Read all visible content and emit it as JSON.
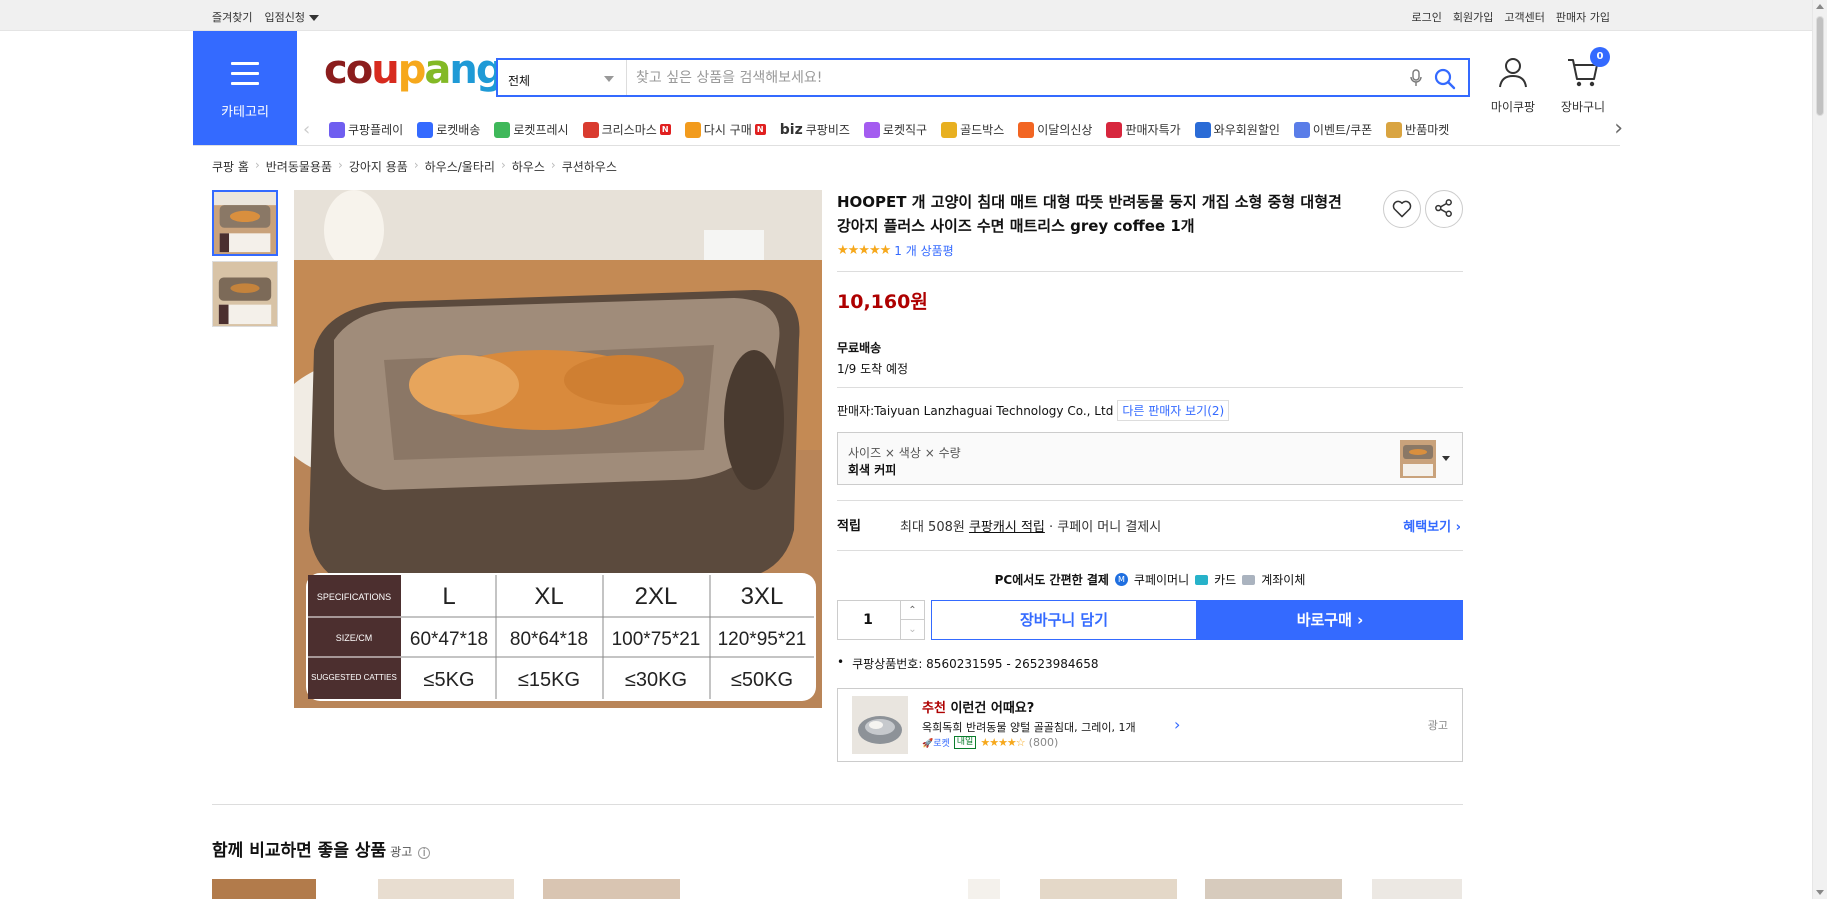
{
  "topbar": {
    "left": {
      "bookmark": "즐겨찾기",
      "seller_apply": "입점신청"
    },
    "right": [
      "로그인",
      "회원가입",
      "고객센터",
      "판매자 가입"
    ]
  },
  "header": {
    "category_label": "카테고리",
    "logo_letters": [
      "c",
      "o",
      "u",
      "p",
      "a",
      "n",
      "g"
    ],
    "search": {
      "select_value": "전체",
      "placeholder": "찾고 싶은 상품을 검색해보세요!"
    },
    "mycoupang_label": "마이쿠팡",
    "cart_label": "장바구니",
    "cart_count": "0"
  },
  "menu": [
    {
      "label": "쿠팡플레이",
      "icon": "play-icon",
      "color": "#6f5ef0"
    },
    {
      "label": "로켓배송",
      "icon": "rocket-icon",
      "color": "#346aff"
    },
    {
      "label": "로켓프레시",
      "icon": "rocket-fresh-icon",
      "color": "#3fb85a"
    },
    {
      "label": "크리스마스",
      "icon": "santa-icon",
      "color": "#d93b2f",
      "new": "N"
    },
    {
      "label": "다시 구매",
      "icon": "home-icon",
      "color": "#f29b1d",
      "new": "N"
    },
    {
      "label": "쿠팡비즈",
      "icon": "biz-icon",
      "color": "#333333",
      "prefix": "biz"
    },
    {
      "label": "로켓직구",
      "icon": "globe-icon",
      "color": "#a45cf0"
    },
    {
      "label": "골드박스",
      "icon": "giftbox-icon",
      "color": "#e8b020"
    },
    {
      "label": "이달의신상",
      "icon": "new-bag-icon",
      "color": "#f26522"
    },
    {
      "label": "판매자특가",
      "icon": "percent-icon",
      "color": "#d7263d"
    },
    {
      "label": "와우회원할인",
      "icon": "wow-icon",
      "color": "#2a6bd6"
    },
    {
      "label": "이벤트/쿠폰",
      "icon": "coupon-icon",
      "color": "#5a7de8"
    },
    {
      "label": "반품마켓",
      "icon": "market-icon",
      "color": "#d9a441"
    }
  ],
  "breadcrumb": [
    "쿠팡 홈",
    "반려동물용품",
    "강아지 용품",
    "하우스/울타리",
    "하우스",
    "쿠션하우스"
  ],
  "product": {
    "title": "HOOPET 개 고양이 침대 매트 대형 따뜻 반려동물 둥지 개집 소형 중형 대형견 강아지 플러스 사이즈 수면 매트리스 grey coffee 1개",
    "rating_stars": 5,
    "review_text": "1 개 상품평",
    "price": "10,160원",
    "shipping_label": "무료배송",
    "arrival": "1/9 도착 예정",
    "seller_prefix": "판매자:",
    "seller": "Taiyuan Lanzhaguai Technology Co., Ltd",
    "other_sellers": "다른 판매자 보기(2)",
    "option_header": "사이즈 × 색상 × 수량",
    "option_value": "회색 커피",
    "reward_label": "적립",
    "reward_text_pre": "최대 508원",
    "reward_link": "쿠팡캐시 적립",
    "reward_text_post": "· 쿠페이 머니 결제시",
    "benefit_link": "혜택보기",
    "pay_label": "PC에서도 간편한 결제",
    "pay_methods": [
      "쿠페이머니",
      "카드",
      "계좌이체"
    ],
    "quantity": "1",
    "cart_button": "장바구니 담기",
    "buy_button": "바로구매",
    "product_number": "쿠팡상품번호: 8560231595 - 26523984658"
  },
  "image_table": {
    "headers": [
      "SPECIFICATIONS",
      "L",
      "XL",
      "2XL",
      "3XL"
    ],
    "rows": [
      [
        "SIZE/CM",
        "60*47*18",
        "80*64*18",
        "100*75*21",
        "120*95*21"
      ],
      [
        "SUGGESTED CATTIES",
        "≤5KG",
        "≤15KG",
        "≤30KG",
        "≤50KG"
      ]
    ]
  },
  "recommendation": {
    "label_accent": "추천",
    "label_rest": " 이런건 어때요?",
    "product": "옥희독희 반려동물 양털 골골침대, 그레이, 1개",
    "rocket": "로켓",
    "tomorrow": "내일",
    "review_count": "(800)",
    "stars": 4.5,
    "ad": "광고"
  },
  "compare": {
    "title": "함께 비교하면 좋을 상품",
    "ad": "광고"
  },
  "colors": {
    "accent": "#346aff",
    "price": "#ae0000"
  }
}
